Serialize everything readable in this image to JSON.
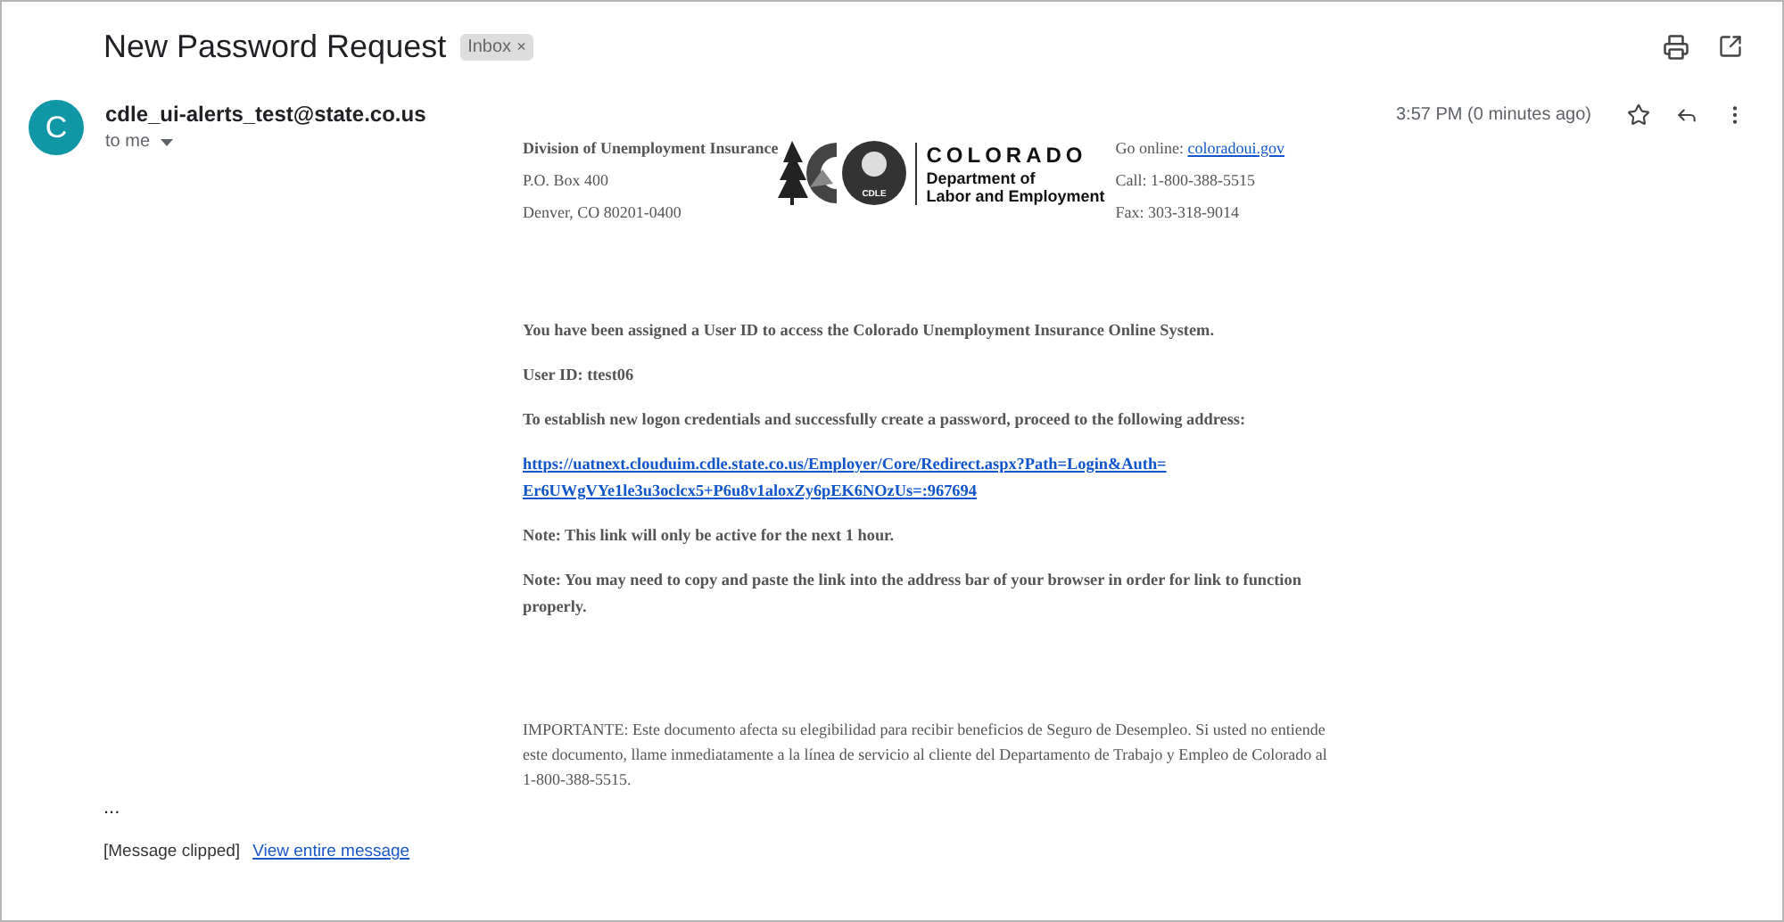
{
  "subject": "New Password Request",
  "label": {
    "text": "Inbox",
    "remove": "×"
  },
  "sender": {
    "initial": "C",
    "email": "cdle_ui-alerts_test@state.co.us",
    "recipient": "to me",
    "time": "3:57 PM (0 minutes ago)",
    "starred": false
  },
  "letterhead": {
    "address": [
      {
        "text": "Division of Unemployment Insurance",
        "kind": "heading"
      },
      {
        "text": "P.O. Box 400",
        "kind": "plain"
      },
      {
        "text": "Denver, CO 80201-0400",
        "kind": "plain"
      }
    ],
    "logo": {
      "badge": "CDLE",
      "name": "COLORADO",
      "department": [
        "Department of",
        "Labor and Employment"
      ]
    },
    "contact": [
      {
        "label": "Go online: ",
        "link": "coloradoui.gov"
      },
      {
        "label": "Call: 1-800-388-5515"
      },
      {
        "label": "Fax: 303-318-9014"
      }
    ]
  },
  "body": [
    {
      "kind": "text",
      "text": "You have been assigned a User ID to access the Colorado Unemployment Insurance Online System."
    },
    {
      "kind": "text",
      "text": "User ID: ttest06"
    },
    {
      "kind": "text",
      "text": "To establish new logon credentials and successfully create a password, proceed to the following address:"
    },
    {
      "kind": "link",
      "lines": [
        "https://uatnext.clouduim.cdle.state.co.us/Employer/Core/Redirect.aspx?Path=Login&Auth=",
        "Er6UWgVYe1le3u3oclcx5+P6u8v1aloxZy6pEK6NOzUs=:967694"
      ]
    },
    {
      "kind": "text",
      "text": "Note: This link will only be active for the next 1 hour."
    },
    {
      "kind": "text",
      "text": "Note: You may need to copy and paste the link into the address bar of your browser in order for link to function properly."
    }
  ],
  "notice": "IMPORTANTE: Este documento afecta su elegibilidad para recibir beneficios de Seguro de Desempleo. Si usted no entiende este documento, llame inmediatamente a la línea de servicio al cliente del Departamento de Trabajo y Empleo de Colorado al 1-800-388-5515.",
  "ellipsis": "...",
  "clipped": {
    "text": "[Message clipped]",
    "link": "View entire message"
  }
}
